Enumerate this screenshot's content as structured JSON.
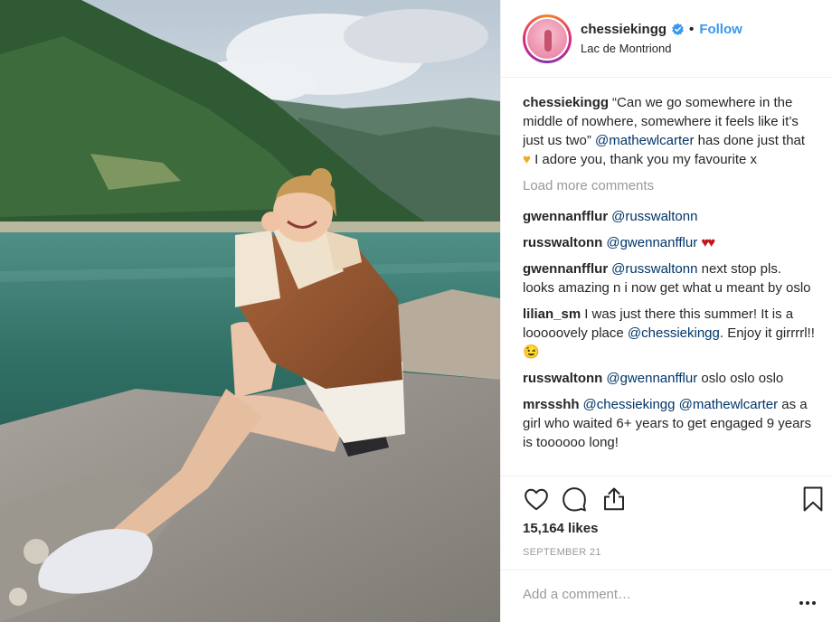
{
  "header": {
    "username": "chessiekingg",
    "follow_label": "Follow",
    "dot": "•",
    "location": "Lac de Montriond",
    "avatar_icon": "profile-avatar",
    "verified_icon": "verified-badge-icon"
  },
  "caption": {
    "user": "chessiekingg",
    "text_1": "“Can we go somewhere in the middle of nowhere, somewhere it feels like it’s just us two”",
    "mention": "@mathewlcarter",
    "text_2": "has done just that",
    "emoji": "♥",
    "text_3": "I adore you, thank you my favourite x"
  },
  "load_more_label": "Load more comments",
  "comments": [
    {
      "user": "gwennanfflur",
      "mention_1": "@russwaltonn",
      "text": "",
      "mention_2": "",
      "text_2": "",
      "emoji": ""
    },
    {
      "user": "russwaltonn",
      "mention_1": "@gwennanfflur",
      "text": "",
      "mention_2": "",
      "text_2": "",
      "emoji": "♥♥"
    },
    {
      "user": "gwennanfflur",
      "mention_1": "@russwaltonn",
      "text": "next stop pls. looks amazing n i now get what u meant by oslo",
      "mention_2": "",
      "text_2": "",
      "emoji": ""
    },
    {
      "user": "lilian_sm",
      "mention_1": "",
      "text": "I was just there this summer! It is a looooovely place",
      "mention_2": "@chessiekingg",
      "text_2": ". Enjoy it girrrrl!!",
      "emoji": "😉"
    },
    {
      "user": "russwaltonn",
      "mention_1": "@gwennanfflur",
      "text": "oslo oslo oslo",
      "mention_2": "",
      "text_2": "",
      "emoji": ""
    },
    {
      "user": "mrssshh",
      "mention_1": "@chessiekingg",
      "text": "",
      "mention_2": "@mathewlcarter",
      "text_2": "as a girl who waited 6+ years to get engaged 9 years is toooooo long!",
      "emoji": ""
    }
  ],
  "actions": {
    "like_icon": "heart-outline-icon",
    "comment_icon": "comment-bubble-icon",
    "share_icon": "share-upload-icon",
    "save_icon": "bookmark-icon"
  },
  "likes_text": "15,164 likes",
  "date_text": "SEPTEMBER 21",
  "add_comment_placeholder": "Add a comment…",
  "more_icon": "more-options-icon",
  "colors": {
    "accent": "#3897f0",
    "mention": "#003569",
    "muted": "#999999",
    "text": "#262626"
  }
}
